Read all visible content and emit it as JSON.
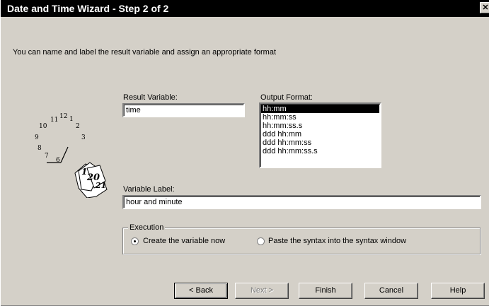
{
  "window": {
    "title": "Date and Time Wizard - Step 2 of 2",
    "close_glyph": "✕"
  },
  "intro_text": "You can name and label the result variable and assign an appropriate format",
  "result_variable": {
    "label": "Result Variable:",
    "value": "time"
  },
  "output_format": {
    "label": "Output Format:",
    "items": [
      "hh:mm",
      "hh:mm:ss",
      "hh:mm:ss.s",
      "ddd hh:mm",
      "ddd hh:mm:ss",
      "ddd hh:mm:ss.s"
    ],
    "selected_index": 0
  },
  "variable_label": {
    "label": "Variable Label:",
    "value": "hour and minute"
  },
  "execution": {
    "legend": "Execution",
    "options": [
      {
        "label": "Create the variable now",
        "checked": true
      },
      {
        "label": "Paste the syntax into the syntax window",
        "checked": false
      }
    ]
  },
  "clock_numbers": [
    "12",
    "1",
    "2",
    "3",
    "11",
    "10",
    "9",
    "8",
    "7",
    "6"
  ],
  "calendar_numbers": [
    "1",
    "20",
    "21"
  ],
  "buttons": {
    "back": "< Back",
    "next": "Next >",
    "finish": "Finish",
    "cancel": "Cancel",
    "help": "Help"
  }
}
